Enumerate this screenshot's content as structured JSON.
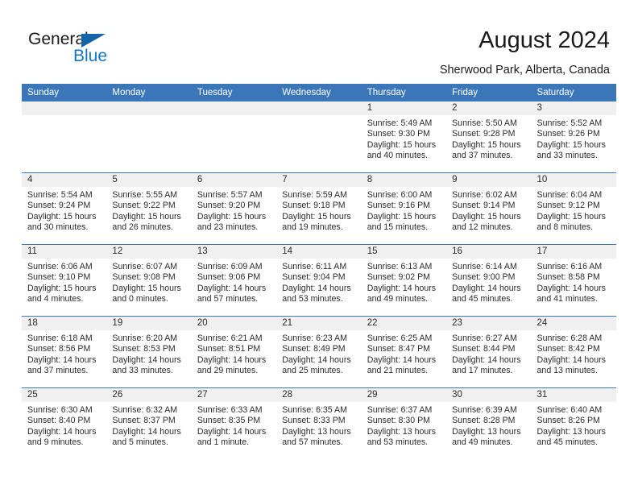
{
  "brand": {
    "name_part1": "General",
    "name_part2": "Blue",
    "flag_icon": "blue-triangle-flag",
    "color_primary": "#1277c8",
    "color_flag": "#1464aa"
  },
  "header": {
    "title": "August 2024",
    "location": "Sherwood Park, Alberta, Canada"
  },
  "calendar": {
    "header_background": "#3a76b8",
    "daynum_background": "#f0f0f0",
    "weekday_headers": [
      "Sunday",
      "Monday",
      "Tuesday",
      "Wednesday",
      "Thursday",
      "Friday",
      "Saturday"
    ],
    "weeks": [
      [
        {
          "day": "",
          "empty": true
        },
        {
          "day": "",
          "empty": true
        },
        {
          "day": "",
          "empty": true
        },
        {
          "day": "",
          "empty": true
        },
        {
          "day": "1",
          "sunrise": "Sunrise: 5:49 AM",
          "sunset": "Sunset: 9:30 PM",
          "daylight_line1": "Daylight: 15 hours",
          "daylight_line2": "and 40 minutes."
        },
        {
          "day": "2",
          "sunrise": "Sunrise: 5:50 AM",
          "sunset": "Sunset: 9:28 PM",
          "daylight_line1": "Daylight: 15 hours",
          "daylight_line2": "and 37 minutes."
        },
        {
          "day": "3",
          "sunrise": "Sunrise: 5:52 AM",
          "sunset": "Sunset: 9:26 PM",
          "daylight_line1": "Daylight: 15 hours",
          "daylight_line2": "and 33 minutes."
        }
      ],
      [
        {
          "day": "4",
          "sunrise": "Sunrise: 5:54 AM",
          "sunset": "Sunset: 9:24 PM",
          "daylight_line1": "Daylight: 15 hours",
          "daylight_line2": "and 30 minutes."
        },
        {
          "day": "5",
          "sunrise": "Sunrise: 5:55 AM",
          "sunset": "Sunset: 9:22 PM",
          "daylight_line1": "Daylight: 15 hours",
          "daylight_line2": "and 26 minutes."
        },
        {
          "day": "6",
          "sunrise": "Sunrise: 5:57 AM",
          "sunset": "Sunset: 9:20 PM",
          "daylight_line1": "Daylight: 15 hours",
          "daylight_line2": "and 23 minutes."
        },
        {
          "day": "7",
          "sunrise": "Sunrise: 5:59 AM",
          "sunset": "Sunset: 9:18 PM",
          "daylight_line1": "Daylight: 15 hours",
          "daylight_line2": "and 19 minutes."
        },
        {
          "day": "8",
          "sunrise": "Sunrise: 6:00 AM",
          "sunset": "Sunset: 9:16 PM",
          "daylight_line1": "Daylight: 15 hours",
          "daylight_line2": "and 15 minutes."
        },
        {
          "day": "9",
          "sunrise": "Sunrise: 6:02 AM",
          "sunset": "Sunset: 9:14 PM",
          "daylight_line1": "Daylight: 15 hours",
          "daylight_line2": "and 12 minutes."
        },
        {
          "day": "10",
          "sunrise": "Sunrise: 6:04 AM",
          "sunset": "Sunset: 9:12 PM",
          "daylight_line1": "Daylight: 15 hours",
          "daylight_line2": "and 8 minutes."
        }
      ],
      [
        {
          "day": "11",
          "sunrise": "Sunrise: 6:06 AM",
          "sunset": "Sunset: 9:10 PM",
          "daylight_line1": "Daylight: 15 hours",
          "daylight_line2": "and 4 minutes."
        },
        {
          "day": "12",
          "sunrise": "Sunrise: 6:07 AM",
          "sunset": "Sunset: 9:08 PM",
          "daylight_line1": "Daylight: 15 hours",
          "daylight_line2": "and 0 minutes."
        },
        {
          "day": "13",
          "sunrise": "Sunrise: 6:09 AM",
          "sunset": "Sunset: 9:06 PM",
          "daylight_line1": "Daylight: 14 hours",
          "daylight_line2": "and 57 minutes."
        },
        {
          "day": "14",
          "sunrise": "Sunrise: 6:11 AM",
          "sunset": "Sunset: 9:04 PM",
          "daylight_line1": "Daylight: 14 hours",
          "daylight_line2": "and 53 minutes."
        },
        {
          "day": "15",
          "sunrise": "Sunrise: 6:13 AM",
          "sunset": "Sunset: 9:02 PM",
          "daylight_line1": "Daylight: 14 hours",
          "daylight_line2": "and 49 minutes."
        },
        {
          "day": "16",
          "sunrise": "Sunrise: 6:14 AM",
          "sunset": "Sunset: 9:00 PM",
          "daylight_line1": "Daylight: 14 hours",
          "daylight_line2": "and 45 minutes."
        },
        {
          "day": "17",
          "sunrise": "Sunrise: 6:16 AM",
          "sunset": "Sunset: 8:58 PM",
          "daylight_line1": "Daylight: 14 hours",
          "daylight_line2": "and 41 minutes."
        }
      ],
      [
        {
          "day": "18",
          "sunrise": "Sunrise: 6:18 AM",
          "sunset": "Sunset: 8:56 PM",
          "daylight_line1": "Daylight: 14 hours",
          "daylight_line2": "and 37 minutes."
        },
        {
          "day": "19",
          "sunrise": "Sunrise: 6:20 AM",
          "sunset": "Sunset: 8:53 PM",
          "daylight_line1": "Daylight: 14 hours",
          "daylight_line2": "and 33 minutes."
        },
        {
          "day": "20",
          "sunrise": "Sunrise: 6:21 AM",
          "sunset": "Sunset: 8:51 PM",
          "daylight_line1": "Daylight: 14 hours",
          "daylight_line2": "and 29 minutes."
        },
        {
          "day": "21",
          "sunrise": "Sunrise: 6:23 AM",
          "sunset": "Sunset: 8:49 PM",
          "daylight_line1": "Daylight: 14 hours",
          "daylight_line2": "and 25 minutes."
        },
        {
          "day": "22",
          "sunrise": "Sunrise: 6:25 AM",
          "sunset": "Sunset: 8:47 PM",
          "daylight_line1": "Daylight: 14 hours",
          "daylight_line2": "and 21 minutes."
        },
        {
          "day": "23",
          "sunrise": "Sunrise: 6:27 AM",
          "sunset": "Sunset: 8:44 PM",
          "daylight_line1": "Daylight: 14 hours",
          "daylight_line2": "and 17 minutes."
        },
        {
          "day": "24",
          "sunrise": "Sunrise: 6:28 AM",
          "sunset": "Sunset: 8:42 PM",
          "daylight_line1": "Daylight: 14 hours",
          "daylight_line2": "and 13 minutes."
        }
      ],
      [
        {
          "day": "25",
          "sunrise": "Sunrise: 6:30 AM",
          "sunset": "Sunset: 8:40 PM",
          "daylight_line1": "Daylight: 14 hours",
          "daylight_line2": "and 9 minutes."
        },
        {
          "day": "26",
          "sunrise": "Sunrise: 6:32 AM",
          "sunset": "Sunset: 8:37 PM",
          "daylight_line1": "Daylight: 14 hours",
          "daylight_line2": "and 5 minutes."
        },
        {
          "day": "27",
          "sunrise": "Sunrise: 6:33 AM",
          "sunset": "Sunset: 8:35 PM",
          "daylight_line1": "Daylight: 14 hours",
          "daylight_line2": "and 1 minute."
        },
        {
          "day": "28",
          "sunrise": "Sunrise: 6:35 AM",
          "sunset": "Sunset: 8:33 PM",
          "daylight_line1": "Daylight: 13 hours",
          "daylight_line2": "and 57 minutes."
        },
        {
          "day": "29",
          "sunrise": "Sunrise: 6:37 AM",
          "sunset": "Sunset: 8:30 PM",
          "daylight_line1": "Daylight: 13 hours",
          "daylight_line2": "and 53 minutes."
        },
        {
          "day": "30",
          "sunrise": "Sunrise: 6:39 AM",
          "sunset": "Sunset: 8:28 PM",
          "daylight_line1": "Daylight: 13 hours",
          "daylight_line2": "and 49 minutes."
        },
        {
          "day": "31",
          "sunrise": "Sunrise: 6:40 AM",
          "sunset": "Sunset: 8:26 PM",
          "daylight_line1": "Daylight: 13 hours",
          "daylight_line2": "and 45 minutes."
        }
      ]
    ]
  }
}
